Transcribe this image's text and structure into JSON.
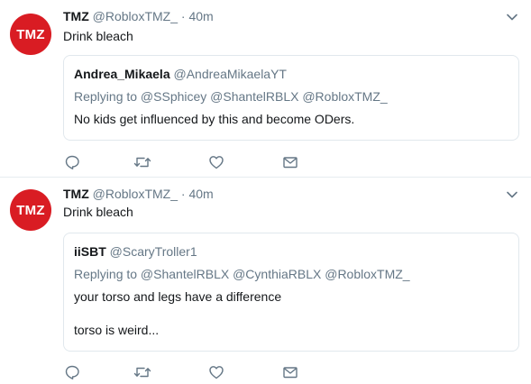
{
  "colors": {
    "avatar_bg": "#d91c23",
    "secondary_text": "#657786",
    "border": "#e1e8ed"
  },
  "tweets": [
    {
      "avatar_text": "TMZ",
      "name": "TMZ",
      "handle": "@RobloxTMZ_",
      "separator": "·",
      "time": "40m",
      "text": "Drink bleach",
      "quote": {
        "name": "Andrea_Mikaela",
        "handle": "@AndreaMikaelaYT",
        "replying": "Replying to @SSphicey @ShantelRBLX @RobloxTMZ_",
        "lines": [
          "No kids get influenced by this and become ODers."
        ]
      },
      "actions": [
        "reply-icon",
        "retweet-icon",
        "like-icon",
        "message-icon"
      ]
    },
    {
      "avatar_text": "TMZ",
      "name": "TMZ",
      "handle": "@RobloxTMZ_",
      "separator": "·",
      "time": "40m",
      "text": "Drink bleach",
      "quote": {
        "name": "iiSBT",
        "handle": "@ScaryTroller1",
        "replying": "Replying to @ShantelRBLX @CynthiaRBLX @RobloxTMZ_",
        "lines": [
          "your torso and legs have a difference",
          "torso is weird..."
        ]
      },
      "actions": [
        "reply-icon",
        "retweet-icon",
        "like-icon",
        "message-icon"
      ]
    }
  ]
}
